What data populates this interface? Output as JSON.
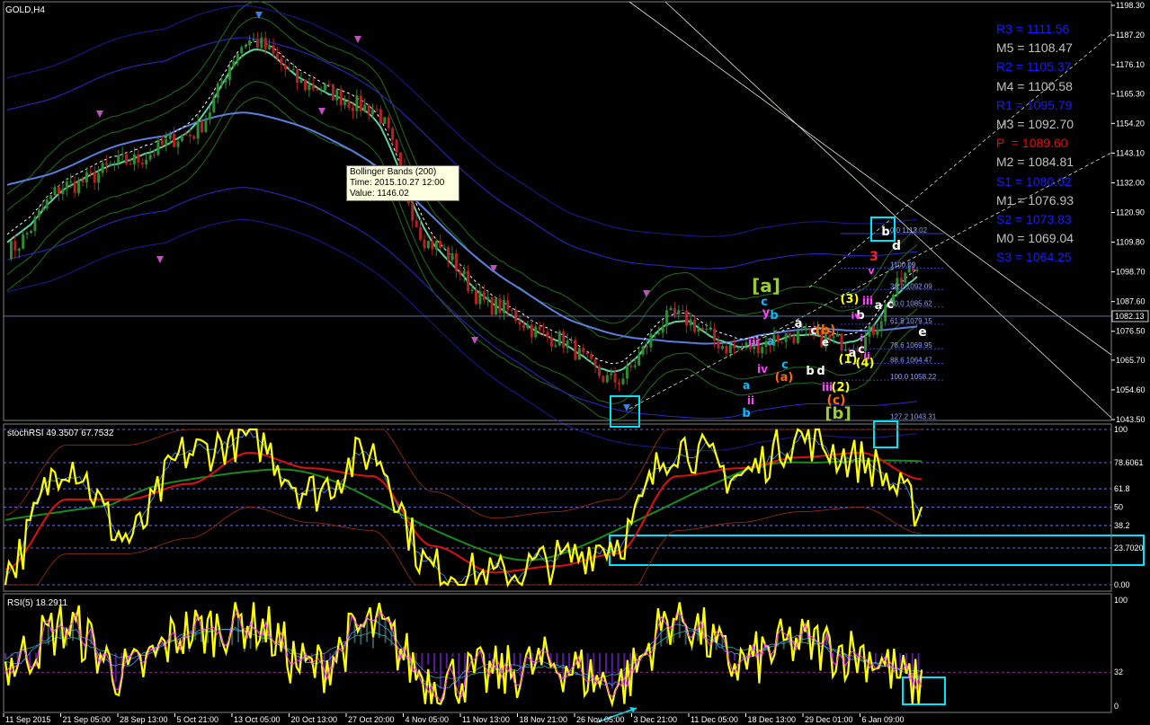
{
  "window": {
    "symbol_label": "GOLD,H4"
  },
  "colors": {
    "background": "#000000",
    "price_up": "#2e8b2e",
    "price_down": "#b22222",
    "band_green": "#1f6f1f",
    "band_blue": "#2a2ad0",
    "ma_light": "#5fd3a0",
    "ma_200": "#5b7fe0",
    "stoch_fast": "#ffff00",
    "stoch_signal": "#e01010",
    "rsi_line": "#ffff00",
    "rsi_signal": "#ff40ff",
    "highlight_box": "#00e5ff",
    "pivot_resistance": "#1a1aff",
    "pivot_mid": "#c0c0c0",
    "pivot_main": "#ff0000",
    "fib_line": "#3a3ab8",
    "trend_line": "#d8e8d8"
  },
  "tooltip": {
    "line1": "Bollinger Bands (200)",
    "line2": "Time: 2015.10.27 12:00",
    "line3": "Value: 1146.02"
  },
  "pivots": [
    {
      "label": "R3 = 1111.56",
      "kind": "resistance"
    },
    {
      "label": "M5 = 1108.47",
      "kind": "mid"
    },
    {
      "label": "R2 = 1105.37",
      "kind": "resistance"
    },
    {
      "label": "M4 = 1100.58",
      "kind": "mid"
    },
    {
      "label": "R1 = 1095.79",
      "kind": "resistance"
    },
    {
      "label": "M3 = 1092.70",
      "kind": "mid"
    },
    {
      "label": "P  = 1089.60",
      "kind": "main"
    },
    {
      "label": "M2 = 1084.81",
      "kind": "mid"
    },
    {
      "label": "S1 = 1080.02",
      "kind": "resistance"
    },
    {
      "label": "M1 = 1076.93",
      "kind": "mid"
    },
    {
      "label": "S2 = 1073.83",
      "kind": "resistance"
    },
    {
      "label": "M0 = 1069.04",
      "kind": "mid"
    },
    {
      "label": "S3 = 1064.25",
      "kind": "resistance"
    }
  ],
  "price_axis_ticks": [
    "1198.30",
    "1187.20",
    "1176.10",
    "1165.30",
    "1154.20",
    "1143.10",
    "1132.00",
    "1120.90",
    "1109.80",
    "1098.70",
    "1087.60",
    "1076.50",
    "1065.70",
    "1054.60",
    "1043.50"
  ],
  "current_price_label": "1082.13",
  "fib_levels": [
    {
      "label": "0.0  1113.02",
      "price": 1113.02
    },
    {
      "label": "1100.09",
      "price": 1100.09
    },
    {
      "label": "38.2  1092.09",
      "price": 1092.09
    },
    {
      "label": "50.0  1085.62",
      "price": 1085.62
    },
    {
      "label": "61.8  1079.15",
      "price": 1079.15
    },
    {
      "label": "78.6  1069.95",
      "price": 1069.95
    },
    {
      "label": "88.6  1064.47",
      "price": 1064.47
    },
    {
      "label": "100.0  1058.22",
      "price": 1058.22
    },
    {
      "label": "127.2  1043.31",
      "price": 1043.31
    }
  ],
  "wave_labels": [
    "[a]",
    "c",
    "y",
    "b",
    "a",
    "iii",
    "iv",
    "c",
    "(a)",
    "a",
    "(b)",
    "c",
    "e",
    "b",
    "d",
    "(1)",
    "iii",
    "(2)",
    "(c)",
    "[b]",
    "ii",
    "b",
    "a",
    "(3)",
    "iii",
    "b",
    "a",
    "c",
    "(4)",
    "3",
    "d",
    "b",
    "a",
    "c",
    "e",
    "i",
    "ii",
    "iv",
    "v"
  ],
  "stoch_panel": {
    "label": "stochRSI 49.3507 67.7532",
    "axis_ticks": [
      "100",
      "78.6061",
      "61.8",
      "50",
      "38.2",
      "23.7020",
      "0.00"
    ]
  },
  "rsi_panel": {
    "label": "RSI(5) 18.2911",
    "axis_ticks": [
      "100",
      "32",
      "0"
    ]
  },
  "time_axis": [
    "11 Sep 2015",
    "21 Sep 05:00",
    "28 Sep 13:00",
    "5 Oct 21:00",
    "13 Oct 05:00",
    "20 Oct 13:00",
    "27 Oct 20:00",
    "4 Nov 05:00",
    "11 Nov 13:00",
    "18 Nov 21:00",
    "26 Nov 05:00",
    "3 Dec 21:00",
    "11 Dec 05:00",
    "18 Dec 13:00",
    "29 Dec 01:00",
    "6 Jan 09:00"
  ],
  "chart_data": [
    {
      "type": "line",
      "title": "GOLD,H4",
      "ylim": [
        1040,
        1200
      ],
      "x": [
        "11 Sep 2015",
        "21 Sep 05:00",
        "28 Sep 13:00",
        "5 Oct 21:00",
        "13 Oct 05:00",
        "20 Oct 13:00",
        "27 Oct 20:00",
        "4 Nov 05:00",
        "11 Nov 13:00",
        "18 Nov 21:00",
        "26 Nov 05:00",
        "3 Dec 21:00",
        "11 Dec 05:00",
        "18 Dec 13:00",
        "29 Dec 01:00",
        "6 Jan 09:00"
      ],
      "series": [
        {
          "values": [
            1107,
            1131,
            1140,
            1150,
            1185,
            1168,
            1160,
            1109,
            1086,
            1074,
            1058,
            1082,
            1070,
            1075,
            1072,
            1100
          ]
        }
      ],
      "current_price": 1082.13
    },
    {
      "type": "line",
      "title": "stochRSI 49.3507 67.7532",
      "ylim": [
        0,
        100
      ],
      "x": [
        "11 Sep 2015",
        "21 Sep 05:00",
        "28 Sep 13:00",
        "5 Oct 21:00",
        "13 Oct 05:00",
        "20 Oct 13:00",
        "27 Oct 20:00",
        "4 Nov 05:00",
        "11 Nov 13:00",
        "18 Nov 21:00",
        "26 Nov 05:00",
        "3 Dec 21:00",
        "11 Dec 05:00",
        "18 Dec 13:00",
        "29 Dec 01:00",
        "6 Jan 09:00"
      ],
      "series": [
        {
          "values": [
            10,
            80,
            30,
            85,
            95,
            60,
            85,
            10,
            5,
            15,
            28,
            90,
            70,
            95,
            80,
            50
          ]
        },
        {
          "values": [
            10,
            55,
            55,
            65,
            85,
            75,
            70,
            25,
            8,
            12,
            20,
            70,
            75,
            82,
            85,
            68
          ]
        }
      ],
      "reference_levels": [
        78.6061,
        61.8,
        50,
        38.2,
        23.702
      ]
    },
    {
      "type": "line",
      "title": "RSI(5) 18.2911",
      "ylim": [
        0,
        100
      ],
      "x": [
        "11 Sep 2015",
        "21 Sep 05:00",
        "28 Sep 13:00",
        "5 Oct 21:00",
        "13 Oct 05:00",
        "20 Oct 13:00",
        "27 Oct 20:00",
        "4 Nov 05:00",
        "11 Nov 13:00",
        "18 Nov 21:00",
        "26 Nov 05:00",
        "3 Dec 21:00",
        "11 Dec 05:00",
        "18 Dec 13:00",
        "29 Dec 01:00",
        "6 Jan 09:00"
      ],
      "series": [
        {
          "values": [
            40,
            75,
            30,
            70,
            80,
            35,
            75,
            25,
            30,
            40,
            20,
            85,
            40,
            60,
            50,
            18
          ]
        }
      ],
      "reference_levels": [
        32
      ]
    }
  ]
}
